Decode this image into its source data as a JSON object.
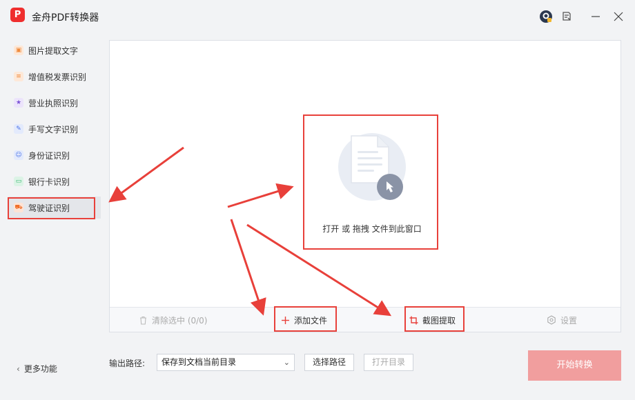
{
  "app": {
    "title": "金舟PDF转换器",
    "logo_text": "P"
  },
  "titlebar": {
    "icons": [
      "user-avatar-icon",
      "feedback-icon",
      "minimize-icon",
      "close-icon"
    ]
  },
  "sidebar": {
    "items": [
      {
        "label": "图片提取文字",
        "icon": "image-text-icon",
        "color": "#f08a3c"
      },
      {
        "label": "增值税发票识别",
        "icon": "invoice-icon",
        "color": "#f08a3c"
      },
      {
        "label": "营业执照识别",
        "icon": "license-icon",
        "color": "#7a52d6"
      },
      {
        "label": "手写文字识别",
        "icon": "handwriting-icon",
        "color": "#4a72e8"
      },
      {
        "label": "身份证识别",
        "icon": "id-card-icon",
        "color": "#4a72e8"
      },
      {
        "label": "银行卡识别",
        "icon": "bank-card-icon",
        "color": "#2fb469"
      },
      {
        "label": "驾驶证识别",
        "icon": "driver-license-icon",
        "color": "#f06f2a",
        "active": true
      }
    ],
    "more_label": "更多功能"
  },
  "main": {
    "drop_text": "打开 或 拖拽 文件到此窗口",
    "toolbar": {
      "clear_label": "清除选中 (0/0)",
      "add_label": "添加文件",
      "crop_label": "截图提取",
      "settings_label": "设置"
    }
  },
  "bottom": {
    "output_label": "输出路径:",
    "output_value": "保存到文档当前目录",
    "choose_path_label": "选择路径",
    "open_dir_label": "打开目录",
    "start_label": "开始转换"
  },
  "colors": {
    "accent_red": "#e8403a",
    "start_button": "#f19e9e",
    "active_item_bg": "#e4e6ea"
  }
}
